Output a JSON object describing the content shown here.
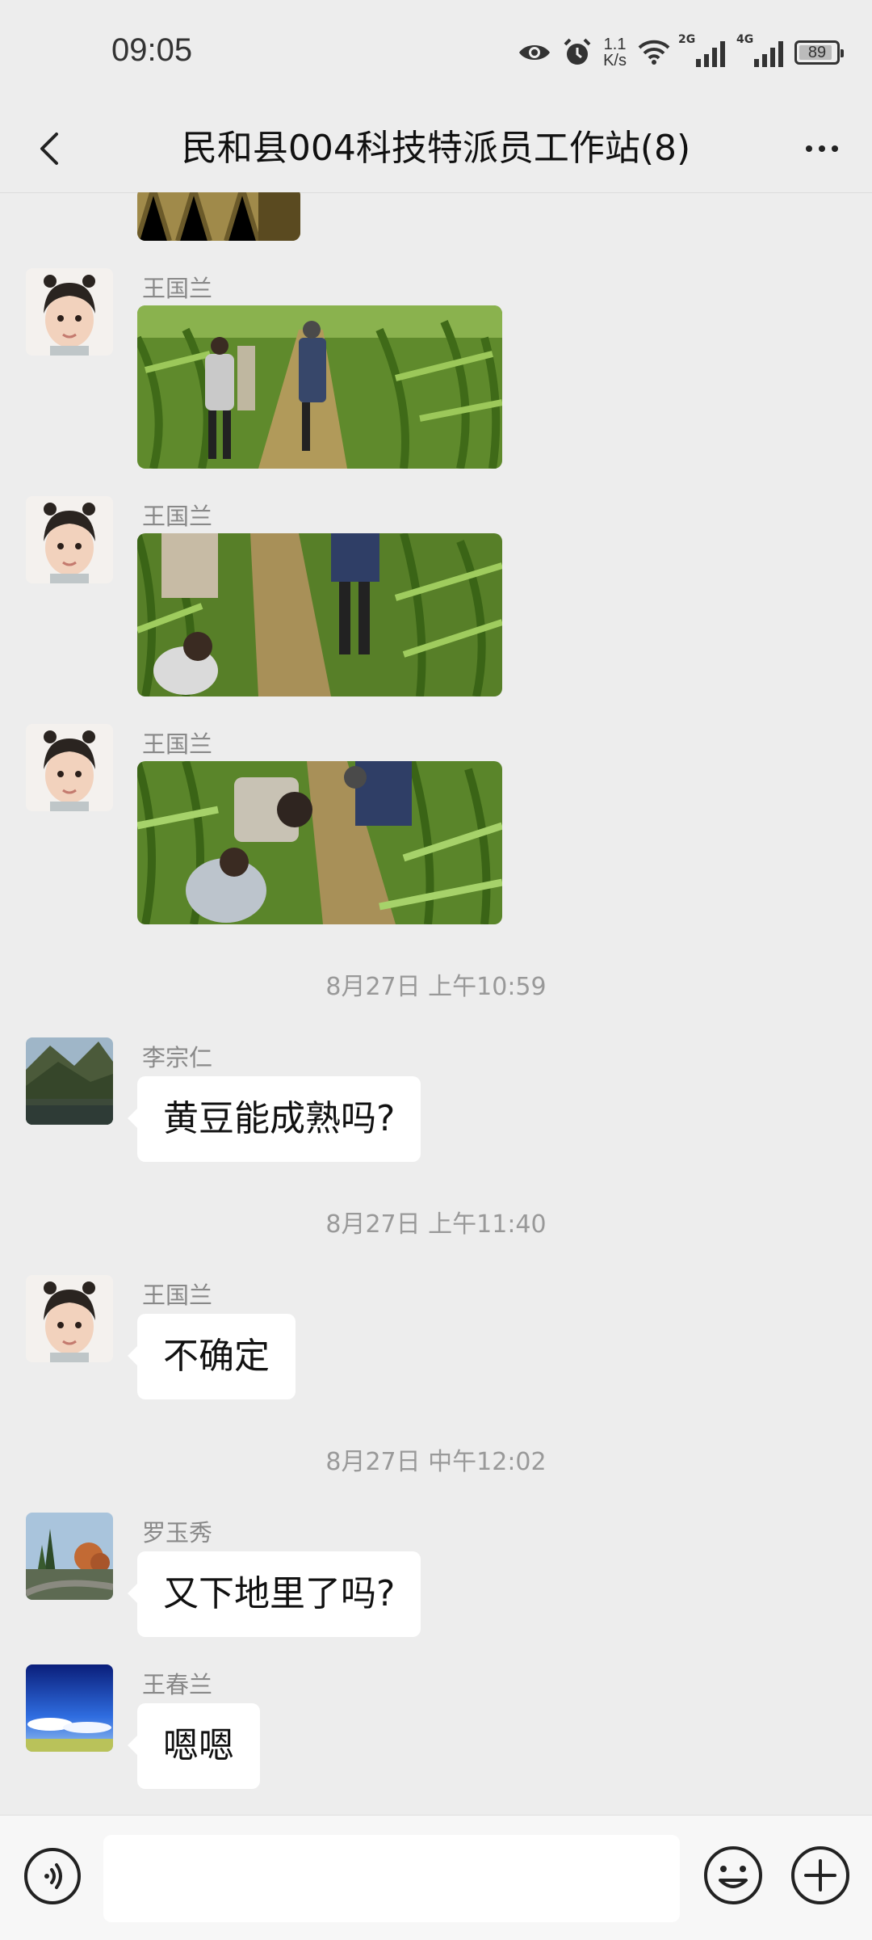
{
  "status_bar": {
    "time": "09:05",
    "net_speed_value": "1.1",
    "net_speed_unit": "K/s",
    "signal_1_label": "2G",
    "signal_2_label": "4G",
    "battery": "89"
  },
  "header": {
    "title": "民和县004科技特派员工作站(8)"
  },
  "messages": [
    {
      "sender": "王国兰"
    },
    {
      "sender": "王国兰"
    },
    {
      "sender": "王国兰"
    },
    {
      "timestamp": "8月27日 上午10:59"
    },
    {
      "sender": "李宗仁",
      "text": "黄豆能成熟吗?"
    },
    {
      "timestamp": "8月27日 上午11:40"
    },
    {
      "sender": "王国兰",
      "text": "不确定"
    },
    {
      "timestamp": "8月27日 中午12:02"
    },
    {
      "sender": "罗玉秀",
      "text": "又下地里了吗?"
    },
    {
      "sender": "王春兰",
      "text": "嗯嗯"
    }
  ],
  "input": {
    "value": "",
    "placeholder": ""
  },
  "colors": {
    "background": "#ededed",
    "bubble": "#ffffff",
    "meta_text": "#999999"
  }
}
